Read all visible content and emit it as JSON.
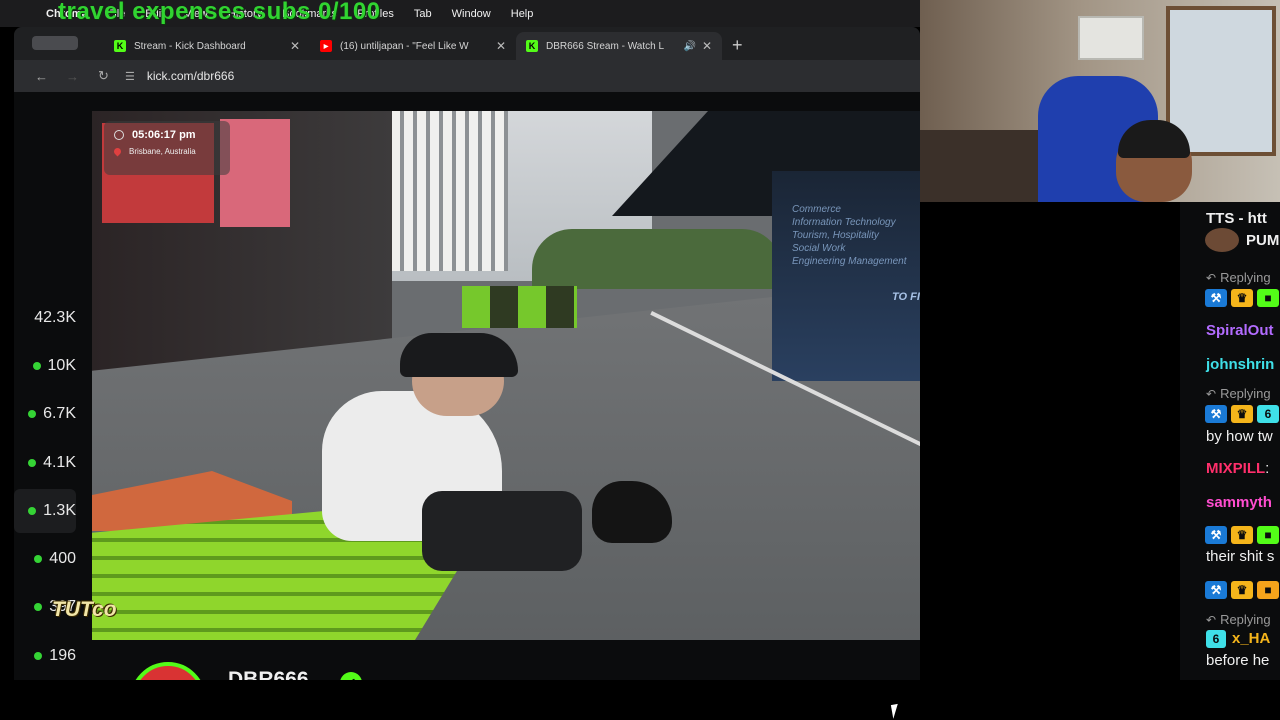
{
  "menubar": {
    "items": [
      "Chrome",
      "File",
      "Edit",
      "View",
      "History",
      "Bookmarks",
      "Profiles",
      "Tab",
      "Window",
      "Help"
    ]
  },
  "overlay": {
    "title": "travel expenses subs 0/100",
    "watermark": "TUTco"
  },
  "browser": {
    "tabs": [
      {
        "label": "Stream - Kick Dashboard",
        "icon": "kick-icon"
      },
      {
        "label": "(16) untiljapan - \"Feel Like W",
        "icon": "youtube-icon"
      },
      {
        "label": "DBR666 Stream - Watch L",
        "icon": "kick-icon",
        "active": true
      }
    ],
    "url": "kick.com/dbr666"
  },
  "sidebar_stats": [
    "42.3K",
    "10K",
    "6.7K",
    "4.1K",
    "1.3K",
    "400",
    "397",
    "196"
  ],
  "video": {
    "time": "05:06:17 pm",
    "location": "Brisbane, Australia",
    "sign_lines": [
      "Commerce",
      "Information Technology",
      "Tourism, Hospitality",
      "Social Work",
      "Engineering Management"
    ],
    "find_out_more": "TO FIND OUT MORE, VISIT"
  },
  "channel": {
    "name": "DBR666"
  },
  "chat": {
    "messages": [
      {
        "type": "text",
        "user": "TTS - htt",
        "text": "",
        "color": "#ffffff"
      },
      {
        "type": "text",
        "user": "",
        "text": "PUM",
        "color": "#ffffff"
      },
      {
        "type": "reply",
        "text": "Replying"
      },
      {
        "type": "user",
        "user": "SpiralOut",
        "color": "#b36cff"
      },
      {
        "type": "user",
        "user": "johnshrin",
        "color": "#3fe0e8"
      },
      {
        "type": "reply",
        "text": "Replying"
      },
      {
        "type": "text",
        "user": "",
        "text": "by how tw",
        "color": "#f0f0f0"
      },
      {
        "type": "user",
        "user": "MIXPILL",
        "color": "#ff2f6b",
        "suffix": ":"
      },
      {
        "type": "user",
        "user": "sammyth",
        "color": "#ff4dcf"
      },
      {
        "type": "text",
        "user": "",
        "text": "their shit s",
        "color": "#f0f0f0"
      },
      {
        "type": "reply",
        "text": "Replying"
      },
      {
        "type": "user",
        "user": "x_HA",
        "color": "#f5b51b"
      },
      {
        "type": "text",
        "user": "",
        "text": "before he",
        "color": "#f0f0f0"
      }
    ]
  },
  "colors": {
    "kick_green": "#53fc18",
    "overlay_green": "#31d431"
  }
}
